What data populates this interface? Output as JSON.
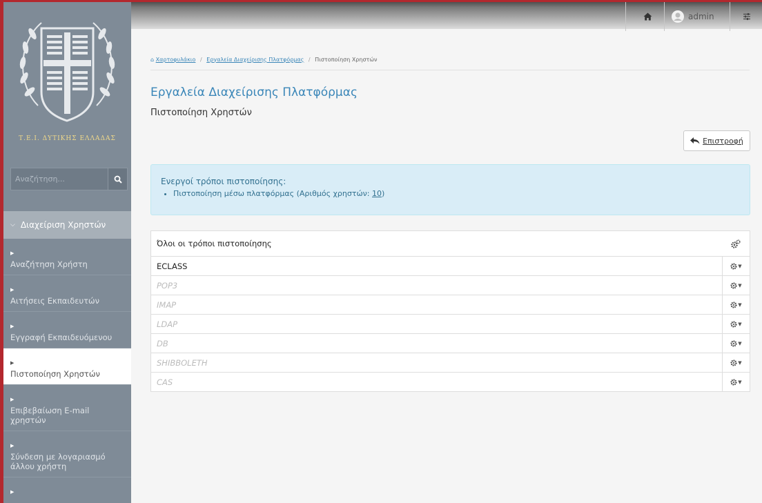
{
  "sidebar": {
    "logo_text": "Τ.Ε.Ι. ΔΥΤΙΚΗΣ ΕΛΛΑΔΑΣ",
    "search_placeholder": "Αναζήτηση...",
    "section_label": "Διαχείριση Χρηστών",
    "items": [
      {
        "label": "Αναζήτηση Χρήστη"
      },
      {
        "label": "Αιτήσεις Εκπαιδευτών"
      },
      {
        "label": "Εγγραφή Εκπαιδευόμενου"
      },
      {
        "label": "Πιστοποίηση Χρηστών"
      },
      {
        "label": "Επιβεβαίωση E-mail χρηστών"
      },
      {
        "label": "Σύνδεση με λογαριασμό άλλου χρήστη"
      }
    ]
  },
  "topbar": {
    "user_name": "admin"
  },
  "breadcrumb": {
    "home": "Χαρτοφυλάκιο",
    "tools": "Εργαλεία Διαχείρισης Πλατφόρμας",
    "current": "Πιστοποίηση Χρηστών"
  },
  "header": {
    "title": "Εργαλεία Διαχείρισης Πλατφόρμας",
    "subtitle": "Πιστοποίηση Χρηστών",
    "back_label": "Επιστροφή"
  },
  "alert": {
    "title": "Ενεργοί τρόποι πιστοποίησης:",
    "item_text": "Πιστοποίηση μέσω πλατφόρμας (Αριθμός χρηστών: ",
    "item_count": "10",
    "item_close": ")"
  },
  "table": {
    "header": "Όλοι οι τρόποι πιστοποίησης",
    "rows": [
      {
        "name": "ECLASS"
      },
      {
        "name": "POP3"
      },
      {
        "name": "IMAP"
      },
      {
        "name": "LDAP"
      },
      {
        "name": "DB"
      },
      {
        "name": "SHIBBOLETH"
      },
      {
        "name": "CAS"
      }
    ]
  }
}
